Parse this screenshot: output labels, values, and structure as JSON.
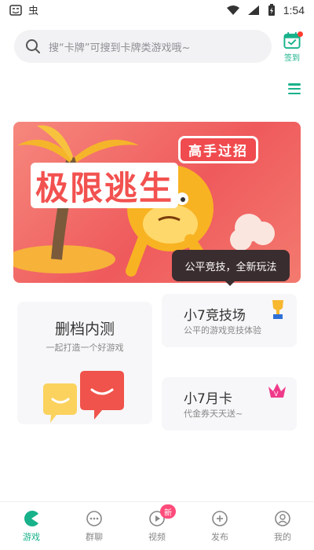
{
  "status": {
    "time": "1:54",
    "left_icons": [
      "face-icon",
      "bug-icon"
    ],
    "right_icons": [
      "wifi-icon",
      "signal-icon",
      "battery-icon"
    ]
  },
  "search": {
    "placeholder": "搜“卡牌”可搜到卡牌类游戏哦~"
  },
  "checkin": {
    "label": "签到"
  },
  "banner": {
    "title": "极限逃生",
    "chip": "高手过招",
    "tooltip": "公平竞技，全新玩法"
  },
  "cards": [
    {
      "title": "删档内测",
      "subtitle": "一起打造一个好游戏"
    },
    {
      "title": "小7竞技场",
      "subtitle": "公平的游戏竞技体验"
    },
    {
      "title": "小7月卡",
      "subtitle": "代金券天天送~"
    }
  ],
  "tabs": [
    {
      "label": "游戏",
      "icon": "pacman-icon",
      "active": true
    },
    {
      "label": "群聊",
      "icon": "chat-icon",
      "active": false
    },
    {
      "label": "视频",
      "icon": "video-icon",
      "active": false,
      "badge": "新"
    },
    {
      "label": "发布",
      "icon": "publish-icon",
      "active": false
    },
    {
      "label": "我的",
      "icon": "me-icon",
      "active": false
    }
  ],
  "colors": {
    "accent": "#17b18a",
    "banner": "#ef5a5c",
    "card_bg": "#f7f7f9"
  }
}
